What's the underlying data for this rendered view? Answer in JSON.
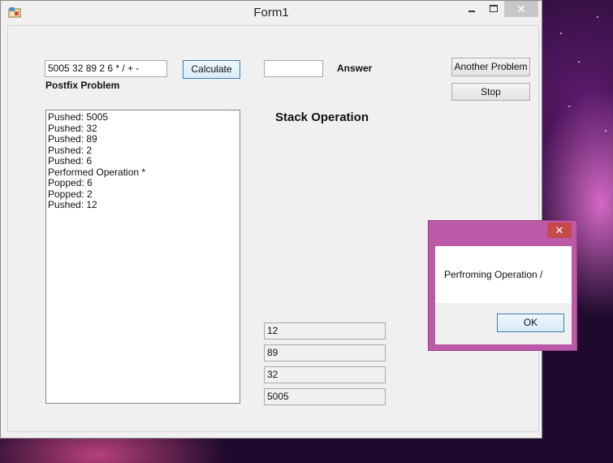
{
  "window": {
    "title": "Form1",
    "close_glyph": "✕"
  },
  "form": {
    "problem_input": "5005 32 89 2 6 * / + -",
    "problem_label": "Postfix Problem",
    "calculate_label": "Calculate",
    "answer_value": "",
    "answer_label": "Answer",
    "another_problem_label": "Another Problem",
    "stop_label": "Stop",
    "stack_title": "Stack Operation",
    "log": [
      "Pushed: 5005",
      "Pushed: 32",
      "Pushed: 89",
      "Pushed: 2",
      "Pushed: 6",
      "Performed Operation *",
      "Popped: 6",
      "Popped: 2",
      "Pushed: 12"
    ],
    "stack": [
      "12",
      "89",
      "32",
      "5005"
    ]
  },
  "dialog": {
    "message": "Perfroming Operation /",
    "ok_label": "OK",
    "close_glyph": "✕"
  }
}
